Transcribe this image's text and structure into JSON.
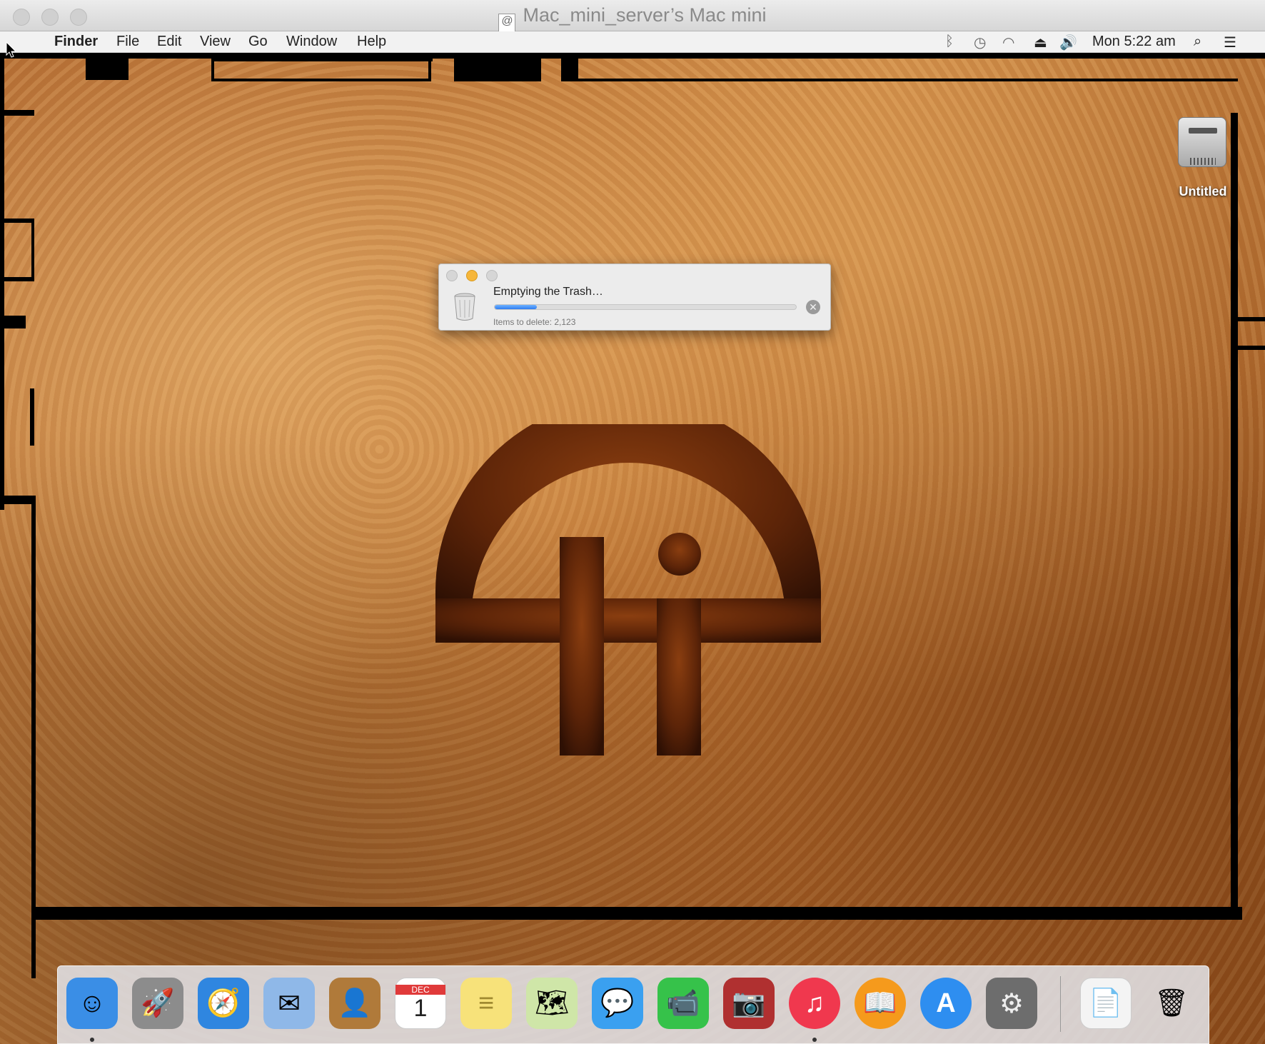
{
  "window": {
    "title": "Mac_mini_server’s Mac mini",
    "doc_icon_glyph": "@"
  },
  "menubar": {
    "apple_glyph": "",
    "items": [
      "Finder",
      "File",
      "Edit",
      "View",
      "Go",
      "Window",
      "Help"
    ],
    "status": {
      "bluetooth": "bluetooth-icon",
      "time_machine": "time-machine-icon",
      "wifi": "wifi-icon",
      "eject": "eject-icon",
      "volume": "volume-icon",
      "clock": "Mon 5:22 am",
      "spotlight": "search-icon",
      "notifications": "notification-center-icon"
    }
  },
  "desktop": {
    "drive_label": "Untitled"
  },
  "dialog": {
    "title": "Emptying the Trash…",
    "progress": 0.14,
    "items_label": "Items to delete: 2,123",
    "cancel_glyph": "✕"
  },
  "dock": {
    "items": [
      {
        "name": "Finder",
        "glyph": "☺",
        "color": "#3a8ee6",
        "running": true
      },
      {
        "name": "Launchpad",
        "glyph": "🚀",
        "color": "#8c8c8c",
        "running": false
      },
      {
        "name": "Safari",
        "glyph": "🧭",
        "color": "#2f86e0",
        "running": false
      },
      {
        "name": "Mail",
        "glyph": "✉",
        "color": "#8fb8e8",
        "running": false
      },
      {
        "name": "Contacts",
        "glyph": "👤",
        "color": "#b07a3a",
        "running": false
      },
      {
        "name": "Calendar",
        "glyph": "1",
        "color": "#ffffff",
        "running": false
      },
      {
        "name": "Notes",
        "glyph": "≡",
        "color": "#f7e27a",
        "running": false
      },
      {
        "name": "Maps",
        "glyph": "🗺",
        "color": "#cfe6a8",
        "running": false
      },
      {
        "name": "Messages",
        "glyph": "💬",
        "color": "#3aa0f0",
        "running": false
      },
      {
        "name": "FaceTime",
        "glyph": "📹",
        "color": "#36c24a",
        "running": false
      },
      {
        "name": "Photo Booth",
        "glyph": "📷",
        "color": "#b03030",
        "running": false
      },
      {
        "name": "iTunes",
        "glyph": "♫",
        "color": "#f0384e",
        "running": true
      },
      {
        "name": "iBooks",
        "glyph": "📖",
        "color": "#f59a1c",
        "running": false
      },
      {
        "name": "App Store",
        "glyph": "A",
        "color": "#2e8ef0",
        "running": false
      },
      {
        "name": "System Preferences",
        "glyph": "⚙",
        "color": "#6d6d6d",
        "running": false
      }
    ],
    "calendar_month": "DEC",
    "stack_glyph": "📄",
    "trash_glyph": "🗑"
  }
}
